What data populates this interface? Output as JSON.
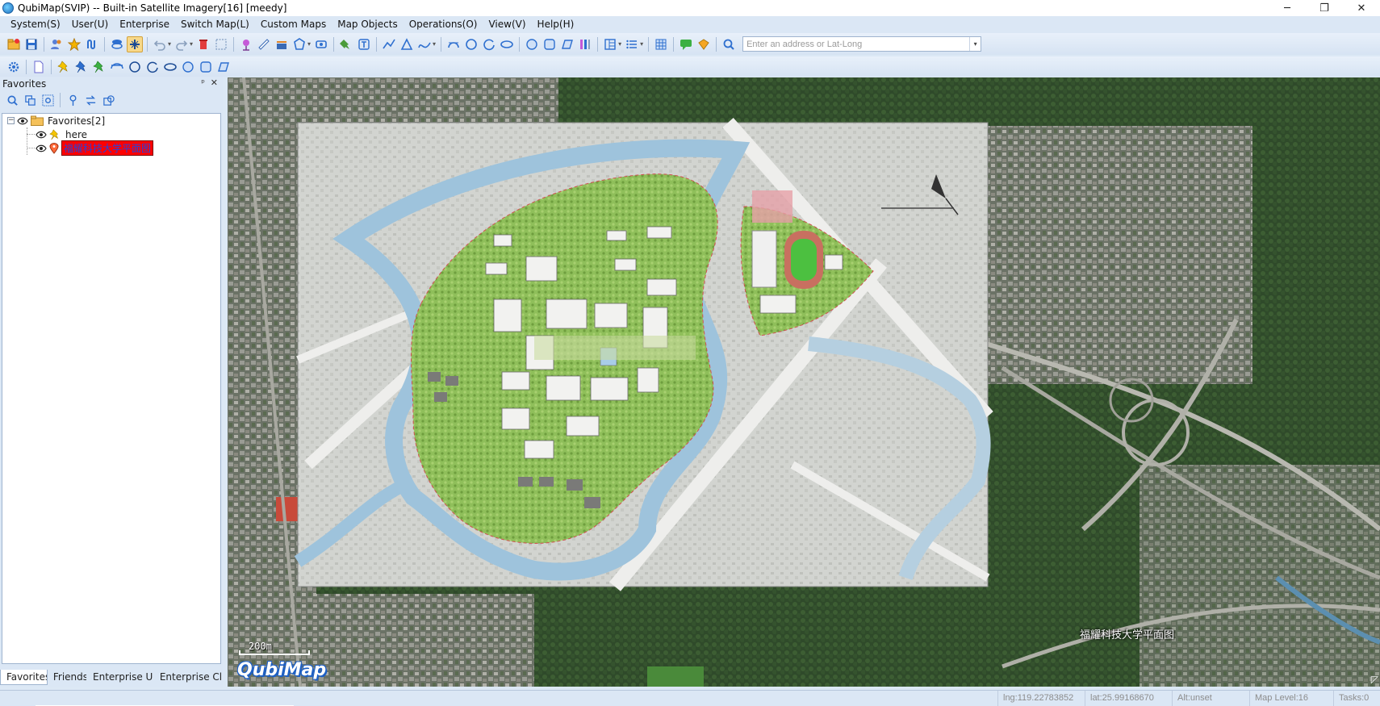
{
  "window": {
    "title": "QubiMap(SVIP) -- Built-in Satellite Imagery[16] [meedy]",
    "minimize": "─",
    "restore": "❐",
    "close": "✕"
  },
  "menu": [
    "System(S)",
    "User(U)",
    "Enterprise",
    "Switch Map(L)",
    "Custom Maps",
    "Map Objects",
    "Operations(O)",
    "View(V)",
    "Help(H)"
  ],
  "search": {
    "placeholder": "Enter an address or Lat-Long",
    "value": ""
  },
  "favorites_panel": {
    "title": "Favorites",
    "pin": "ᵖ",
    "close": "✕",
    "tree": {
      "root_label": "Favorites[2]",
      "root_expander": "−",
      "items": [
        {
          "label": "here"
        },
        {
          "label": "福耀科技大学平面图"
        }
      ]
    },
    "tabs": [
      "Favorites",
      "Friends",
      "Enterprise U...",
      "Enterprise Cl..."
    ]
  },
  "map": {
    "overlay_label": "福耀科技大学平面图",
    "scale_label": "200m",
    "logo_text": "QubiMap",
    "grip": "◸"
  },
  "status": {
    "lng": "lng:119.22783852",
    "lat": "lat:25.99168670",
    "alt": "Alt:unset",
    "level": "Map Level:16",
    "tasks": "Tasks:0"
  },
  "colors": {
    "accent": "#1d5fc4",
    "menu_bg": "#dbe7f5",
    "highlight_bg": "#ff0000",
    "highlight_text": "#2244dd",
    "water": "#9ec3dc",
    "campus_green": "#8fbf5a"
  }
}
